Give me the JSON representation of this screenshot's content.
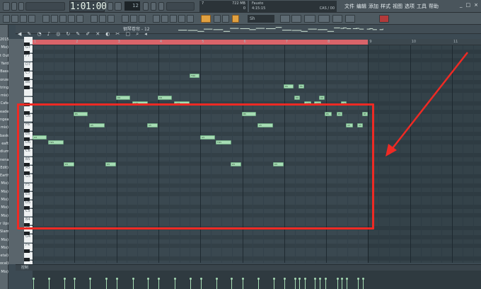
{
  "toolbar": {
    "song_position": "1:01:00",
    "tempo": "12",
    "cpu_ram": {
      "num_a": "7",
      "num_b": "722 MB",
      "num_c": "0"
    },
    "hint": {
      "title": "Fausto",
      "time": "4:15:15",
      "cpu": "CAS / 00"
    },
    "pattern": "Sh"
  },
  "menu": [
    "文件",
    "编辑",
    "添加",
    "样式",
    "视图",
    "选项",
    "工具",
    "帮助"
  ],
  "window_controls": [
    "_",
    "□",
    "×"
  ],
  "piano_roll": {
    "title": "钢琴卷帘 - 12",
    "tool_icons": [
      "arrow-icon",
      "pencil-icon",
      "brush-icon",
      "delete-icon",
      "mute-icon",
      "slice-icon",
      "select-icon",
      "zoom-icon",
      "speaker-icon"
    ]
  },
  "left_column": [
    "2015",
    "Mix)",
    "t Out",
    "Yard",
    "Bass",
    "onze",
    "tring",
    "mix)",
    "Cafe",
    "eader",
    "ngeal",
    "mix)",
    "basket",
    "eaft",
    "dium",
    "nena",
    "Edit)",
    "Earth",
    "Mix)",
    "Mix)",
    "Mix)",
    "Mix)",
    "Mix)",
    "r Ups",
    "Slam",
    "Mix)",
    "Mix)",
    "etal)",
    "ocal)",
    "Mix)"
  ],
  "keyboard_labels": [
    "G7",
    "F7",
    "D7",
    "C7",
    "B6",
    "G6",
    "F6",
    "E6",
    "D6",
    "C6",
    "B5",
    "A5",
    "G5",
    "F5",
    "E5",
    "D5",
    "C5",
    "B4",
    "A4",
    "G4",
    "F4"
  ],
  "ruler_bars": [
    "1",
    "2",
    "3",
    "4",
    "5",
    "6",
    "7",
    "8",
    "9",
    "10",
    "11"
  ],
  "notes": [
    {
      "label": "G5"
    },
    {
      "label": "F#5"
    },
    {
      "label": "D5"
    },
    {
      "label": "B5"
    },
    {
      "label": "A5"
    },
    {
      "label": "D5"
    },
    {
      "label": "D6"
    },
    {
      "label": "C#6"
    },
    {
      "label": "A5"
    },
    {
      "label": "D6"
    },
    {
      "label": "C#6"
    },
    {
      "label": "F#6"
    },
    {
      "label": "G5"
    },
    {
      "label": "F#5"
    },
    {
      "label": "D5"
    },
    {
      "label": "B5"
    },
    {
      "label": "A5"
    },
    {
      "label": "D5"
    },
    {
      "label": "E6"
    },
    {
      "label": "E6"
    },
    {
      "label": "D6"
    },
    {
      "label": "C#6"
    },
    {
      "label": "C#6"
    },
    {
      "label": "D6"
    },
    {
      "label": "B5"
    },
    {
      "label": "B5"
    },
    {
      "label": "C#6"
    },
    {
      "label": "A5"
    },
    {
      "label": "A5"
    },
    {
      "label": "B5"
    }
  ],
  "control_lane": {
    "label": "控制"
  },
  "highlight": {
    "color": "#ef2a24"
  },
  "colors": {
    "note_fill": "#a6dcb4",
    "loop_bar": "#d9646a",
    "grid_bg": "#3a4850"
  }
}
